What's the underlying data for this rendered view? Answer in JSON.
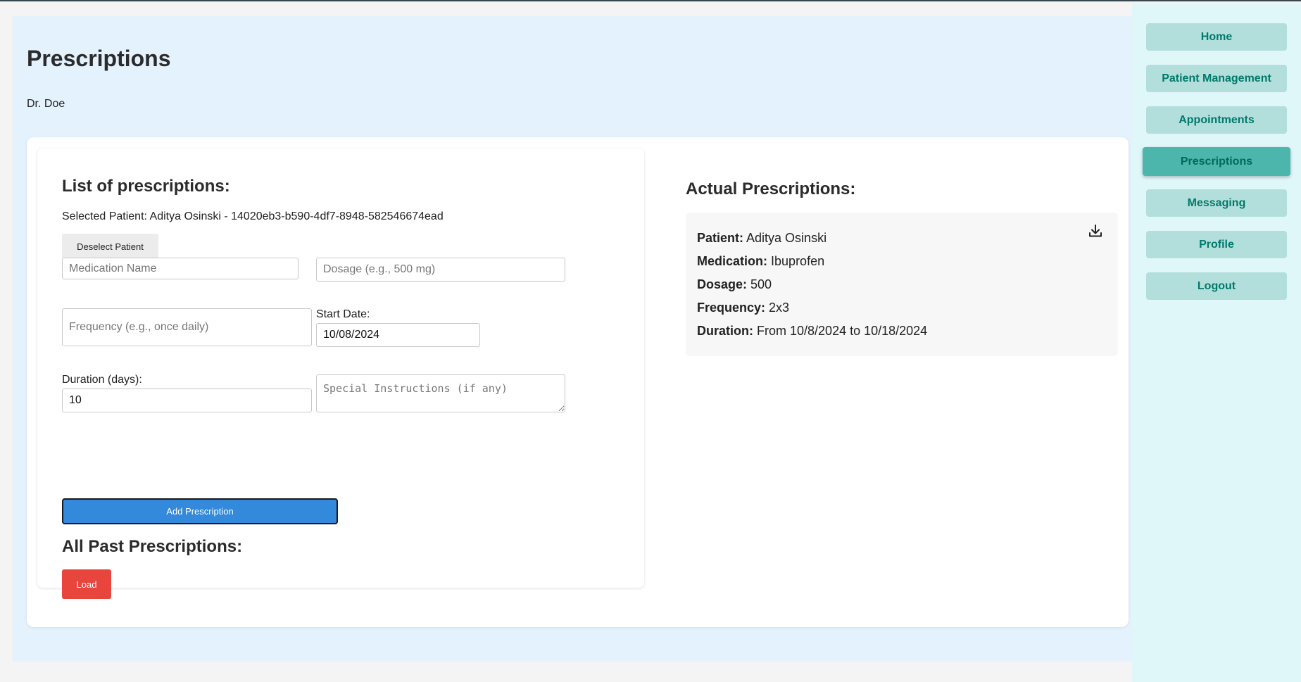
{
  "page": {
    "title": "Prescriptions",
    "doctor_name": "Dr. Doe"
  },
  "form": {
    "heading": "List of prescriptions:",
    "selected_patient": "Selected Patient: Aditya Osinski - 14020eb3-b590-4df7-8948-582546674ead",
    "deselect_label": "Deselect Patient",
    "medication_placeholder": "Medication Name",
    "medication_value": "",
    "dosage_placeholder": "Dosage (e.g., 500 mg)",
    "dosage_value": "",
    "frequency_placeholder": "Frequency (e.g., once daily)",
    "frequency_value": "",
    "start_date_label": "Start Date:",
    "start_date_value": "10/08/2024",
    "duration_label": "Duration (days):",
    "duration_value": "10",
    "instructions_placeholder": "Special Instructions (if any)",
    "instructions_value": "",
    "add_label": "Add Prescription",
    "past_heading": "All Past Prescriptions:",
    "load_label": "Load"
  },
  "actual": {
    "heading": "Actual Prescriptions:",
    "patient_label": "Patient:",
    "patient_value": "Aditya Osinski",
    "medication_label": "Medication:",
    "medication_value": "Ibuprofen",
    "dosage_label": "Dosage:",
    "dosage_value": "500",
    "frequency_label": "Frequency:",
    "frequency_value": "2x3",
    "duration_label": "Duration:",
    "duration_value": "From 10/8/2024 to 10/18/2024",
    "download_icon": "download-icon"
  },
  "sidebar": {
    "items": [
      {
        "label": "Home",
        "active": false
      },
      {
        "label": "Patient Management",
        "active": false
      },
      {
        "label": "Appointments",
        "active": false
      },
      {
        "label": "Prescriptions",
        "active": true
      },
      {
        "label": "Messaging",
        "active": false
      },
      {
        "label": "Profile",
        "active": false
      },
      {
        "label": "Logout",
        "active": false
      }
    ]
  },
  "colors": {
    "main_bg": "#e3f2fd",
    "sidebar_bg": "#e0f7fa",
    "nav_button": "#b2dfdb",
    "nav_active": "#4db6ac",
    "nav_text": "#00796b",
    "add_button": "#3389dc",
    "load_button": "#e8453c"
  }
}
